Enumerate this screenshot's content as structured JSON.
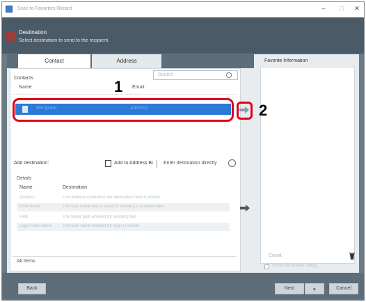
{
  "window": {
    "title": "Scan to Favorites Wizard",
    "minimize": "–",
    "maximize": "□",
    "close": "✕"
  },
  "header": {
    "title": "Destination",
    "subtitle": "Select destination to send to the recipient."
  },
  "tabs": [
    "Contact",
    "Address"
  ],
  "search": {
    "placeholder": "Search"
  },
  "list": {
    "section_label": "Contacts",
    "columns": [
      "Name",
      "Email"
    ],
    "selected_row": {
      "name": "Recipient",
      "value": "Address"
    }
  },
  "toolbar": {
    "count_label": "Add destination:",
    "add_label": "Add to Address Book",
    "direct_label": "Enter destination directly"
  },
  "details": {
    "title": "Details",
    "name_label": "Name",
    "name_value": "Destination",
    "rows": [
      [
        "Address",
        "The address entered in the destination field is shown"
      ],
      [
        "Host Name",
        "The host name that is used for sending is entered here"
      ],
      [
        "Path",
        "The folder path entered for sending files"
      ],
      [
        "Login User Name",
        "The user name entered for login is shown"
      ]
    ]
  },
  "bottom_left_label": "All items",
  "right_panel": {
    "title": "Favorite Information",
    "count_label": "Count",
    "checkbox_label": "Show information dialog"
  },
  "footer": {
    "back": "Back",
    "next": "Next",
    "cancel": "Cancel"
  },
  "annotations": {
    "step1": "1",
    "step2": "2",
    "color": "#e0001b"
  }
}
